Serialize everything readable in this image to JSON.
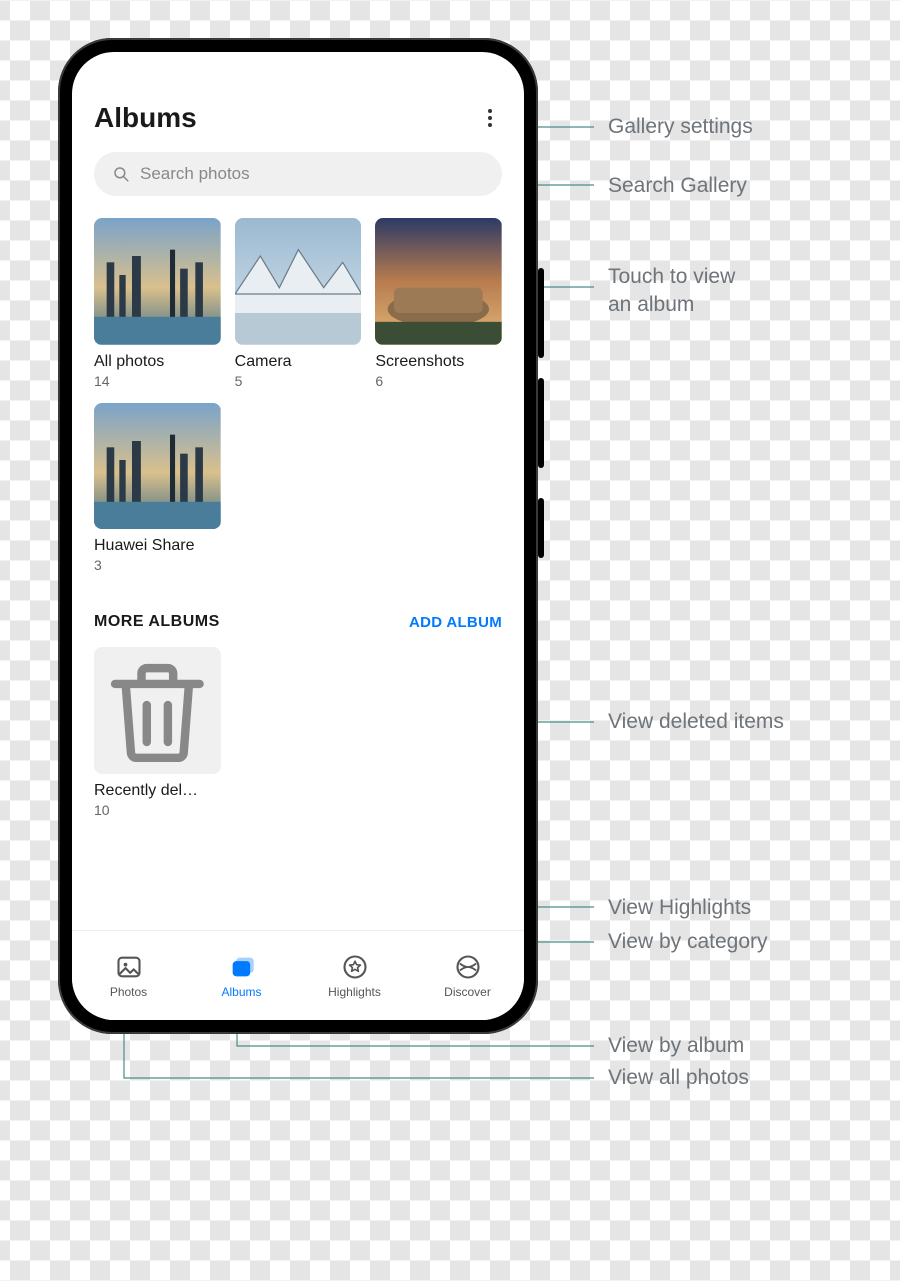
{
  "header": {
    "title": "Albums"
  },
  "search": {
    "placeholder": "Search photos"
  },
  "albums": [
    {
      "name": "All photos",
      "count": "14"
    },
    {
      "name": "Camera",
      "count": "5"
    },
    {
      "name": "Screenshots",
      "count": "6"
    },
    {
      "name": "Huawei Share",
      "count": "3"
    }
  ],
  "more_section": {
    "heading": "MORE ALBUMS",
    "add_label": "ADD ALBUM",
    "items": [
      {
        "name": "Recently del…",
        "count": "10"
      }
    ]
  },
  "nav": {
    "photos": "Photos",
    "albums": "Albums",
    "highlights": "Highlights",
    "discover": "Discover"
  },
  "callouts": {
    "settings": "Gallery settings",
    "search": "Search Gallery",
    "album": "Touch to view\nan album",
    "deleted": "View deleted items",
    "highlights": "View Highlights",
    "category": "View by category",
    "by_album": "View by album",
    "all_photos": "View all photos"
  }
}
